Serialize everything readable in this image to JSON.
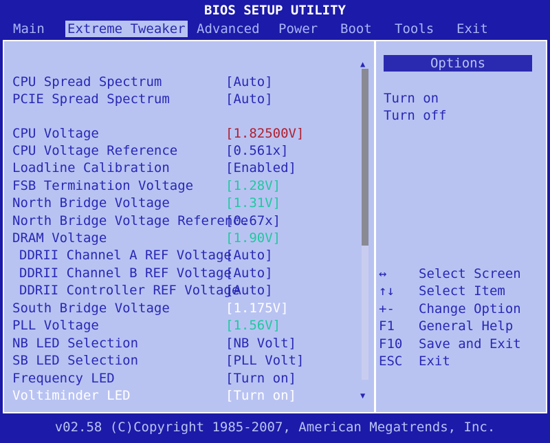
{
  "title": "BIOS SETUP UTILITY",
  "menu": [
    "Main",
    "Extreme Tweaker",
    "Advanced",
    "Power",
    "Boot",
    "Tools",
    "Exit"
  ],
  "settings": [
    {
      "label": "CPU Spread Spectrum",
      "value": "[Auto]"
    },
    {
      "label": "PCIE Spread Spectrum",
      "value": "[Auto]"
    },
    {
      "label": "CPU Voltage",
      "value": "[1.82500V]"
    },
    {
      "label": "CPU Voltage Reference",
      "value": "[0.561x]"
    },
    {
      "label": "Loadline Calibration",
      "value": "[Enabled]"
    },
    {
      "label": "FSB Termination Voltage",
      "value": "[1.28V]"
    },
    {
      "label": "North Bridge Voltage",
      "value": "[1.31V]"
    },
    {
      "label": "North Bridge Voltage Reference",
      "value": "[0.67x]"
    },
    {
      "label": "DRAM Voltage",
      "value": "[1.90V]"
    },
    {
      "label": "DDRII Channel A REF Voltage",
      "value": "[Auto]"
    },
    {
      "label": "DDRII Channel B REF Voltage",
      "value": "[Auto]"
    },
    {
      "label": "DDRII Controller REF Voltage",
      "value": "[Auto]"
    },
    {
      "label": "South Bridge Voltage",
      "value": "[1.175V]"
    },
    {
      "label": "PLL Voltage",
      "value": "[1.56V]"
    },
    {
      "label": "NB LED Selection",
      "value": "[NB Volt]"
    },
    {
      "label": "SB LED Selection",
      "value": "[PLL Volt]"
    },
    {
      "label": "Frequency LED",
      "value": "[Turn on]"
    },
    {
      "label": "Voltiminder LED",
      "value": "[Turn on]"
    }
  ],
  "options": {
    "header": "Options",
    "items": [
      "Turn on",
      "Turn off"
    ]
  },
  "help": [
    {
      "key": "↔",
      "desc": "Select Screen"
    },
    {
      "key": "↑↓",
      "desc": "Select Item"
    },
    {
      "key": "+-",
      "desc": "Change Option"
    },
    {
      "key": "F1",
      "desc": "General Help"
    },
    {
      "key": "F10",
      "desc": "Save and Exit"
    },
    {
      "key": "ESC",
      "desc": "Exit"
    }
  ],
  "footer": "v02.58 (C)Copyright 1985-2007, American Megatrends, Inc.",
  "colors": {
    "background": "#1c1aa8",
    "panel": "#b9c3f2",
    "text": "#2828b4",
    "value_red": "#b02030",
    "value_green": "#20c8a0",
    "value_white": "#ffffff"
  },
  "scrollbar_position": 0.57
}
